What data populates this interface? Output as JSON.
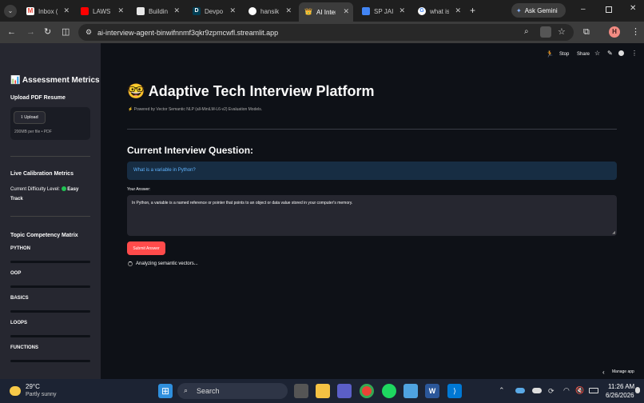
{
  "browser": {
    "tabs": [
      {
        "label": "Inbox (",
        "icon": "gmail-icon"
      },
      {
        "label": "LAWS",
        "icon": "youtube-icon"
      },
      {
        "label": "Buildin",
        "icon": "notion-icon"
      },
      {
        "label": "Devpo",
        "icon": "devpost-icon"
      },
      {
        "label": "hansik",
        "icon": "github-icon"
      },
      {
        "label": "AI Inter",
        "icon": "streamlit-icon"
      },
      {
        "label": "SP JAIN",
        "icon": "doc-icon"
      },
      {
        "label": "what is",
        "icon": "google-icon"
      }
    ],
    "new_tab": "+",
    "ask_gemini": "Ask Gemini",
    "url": "ai-interview-agent-binwifnnmf3qkr9zpmcwfl.streamlit.app",
    "profile_initial": "H"
  },
  "app_toolbar": {
    "stop": "Stop",
    "share": "Share",
    "manage_app": "Manage app"
  },
  "sidebar": {
    "title": "📊 Assessment Metrics",
    "upload_label": "Upload PDF Resume",
    "upload_button": "Upload",
    "upload_hint": "200MB per file • PDF",
    "calibration_title": "Live Calibration Metrics",
    "difficulty_label": "Current Difficulty Level:",
    "difficulty_value": "Easy",
    "difficulty_track": "Track",
    "matrix_title": "Topic Competency Matrix",
    "topics": [
      {
        "label": "PYTHON",
        "progress": 0
      },
      {
        "label": "OOP",
        "progress": 0
      },
      {
        "label": "BASICS",
        "progress": 0
      },
      {
        "label": "LOOPS",
        "progress": 0
      },
      {
        "label": "FUNCTIONS",
        "progress": 0
      }
    ]
  },
  "main": {
    "title": "🤓 Adaptive Tech Interview Platform",
    "caption": "⚡ Powered by Vector Semantic NLP (all-MiniLM-L6-v2) Evaluation Models.",
    "question_heading": "Current Interview Question:",
    "question": "What is a variable in Python?",
    "answer_label": "Your Answer:",
    "answer_value": "In Python, a variable is a named reference or pointer that points to an object or data value stored in your computer's memory.",
    "submit_button": "Submit Answer",
    "spinner_text": "Analyzing semantic vectors..."
  },
  "taskbar": {
    "weather_temp": "29°C",
    "weather_desc": "Partly sunny",
    "search_placeholder": "Search",
    "time": "11:26 AM",
    "date": "6/26/2026"
  },
  "colors": {
    "accent": "#ff4b4b",
    "sidebar_bg": "#262730",
    "main_bg": "#0e1117",
    "info_bg": "#172d43",
    "info_text": "#60b4ff",
    "difficulty_dot": "#21c354"
  }
}
